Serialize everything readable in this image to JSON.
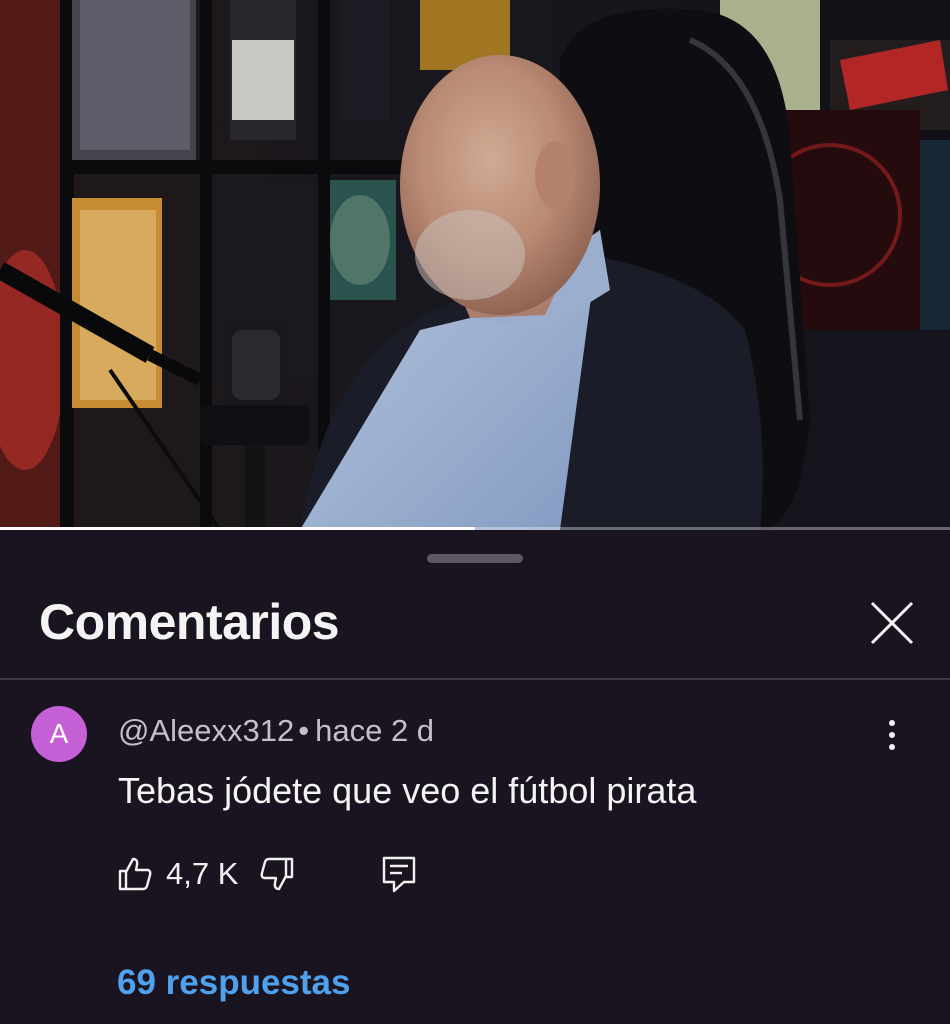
{
  "video": {
    "progress_fraction": 0.5
  },
  "comments_panel": {
    "title": "Comentarios",
    "close_icon": "close-icon"
  },
  "comment": {
    "avatar_letter": "A",
    "avatar_color": "#c660d6",
    "author": "@Aleexx312",
    "separator": "•",
    "time": "hace 2 d",
    "text": "Tebas jódete que veo el fútbol pirata",
    "likes": "4,7 K",
    "icons": {
      "like": "thumb-up-icon",
      "dislike": "thumb-down-icon",
      "reply": "reply-icon",
      "more": "more-vert-icon"
    },
    "replies_label": "69 respuestas",
    "replies_color": "#4fa1ee"
  }
}
